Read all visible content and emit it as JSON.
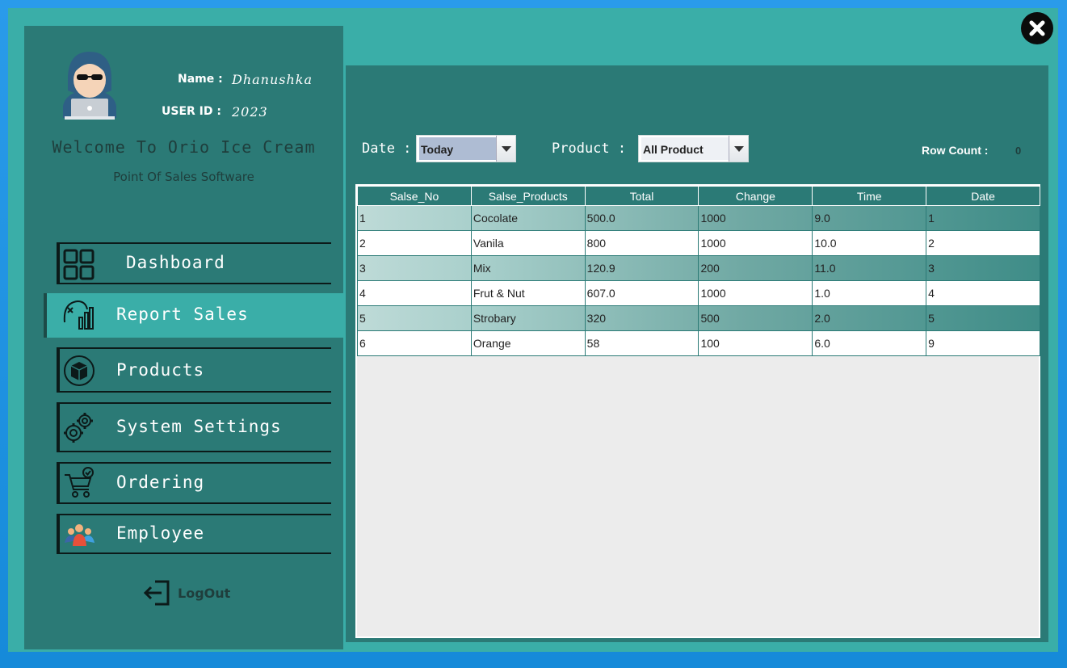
{
  "user": {
    "name_label": "Name :",
    "name": "Dhanushka",
    "id_label": "USER ID :",
    "id": "2023"
  },
  "app": {
    "welcome": "Welcome To Orio Ice Cream",
    "subtitle": "Point Of Sales Software"
  },
  "nav": [
    {
      "label": "Dashboard",
      "icon": "dashboard-grid-icon",
      "active": false
    },
    {
      "label": "Report Sales",
      "icon": "report-chart-icon",
      "active": true
    },
    {
      "label": "Products",
      "icon": "box-icon",
      "active": false
    },
    {
      "label": "System Settings",
      "icon": "gears-icon",
      "active": false
    },
    {
      "label": "Ordering",
      "icon": "cart-check-icon",
      "active": false
    },
    {
      "label": "Employee",
      "icon": "people-icon",
      "active": false
    }
  ],
  "logout": {
    "label": "LogOut",
    "icon": "logout-icon"
  },
  "filters": {
    "date_label": "Date :",
    "date_value": "Today",
    "product_label": "Product :",
    "product_value": "All Product",
    "row_count_label": "Row Count :",
    "row_count": "0"
  },
  "table": {
    "columns": [
      "Salse_No",
      "Salse_Products",
      "Total",
      "Change",
      "Time",
      "Date"
    ],
    "rows": [
      [
        "1",
        "Cocolate",
        "500.0",
        "1000",
        "9.0",
        "1"
      ],
      [
        "2",
        "Vanila",
        "800",
        "1000",
        "10.0",
        "2"
      ],
      [
        "3",
        "Mix",
        "120.9",
        "200",
        "11.0",
        "3"
      ],
      [
        "4",
        "Frut & Nut",
        "607.0",
        "1000",
        "1.0",
        "4"
      ],
      [
        "5",
        "Strobary",
        "320",
        "500",
        "2.0",
        "5"
      ],
      [
        "6",
        "Orange",
        "58",
        "100",
        "6.0",
        "9"
      ]
    ]
  },
  "colors": {
    "panel": "#2b7a76",
    "window": "#3aaea8",
    "desktop": "#1e8fe0"
  }
}
